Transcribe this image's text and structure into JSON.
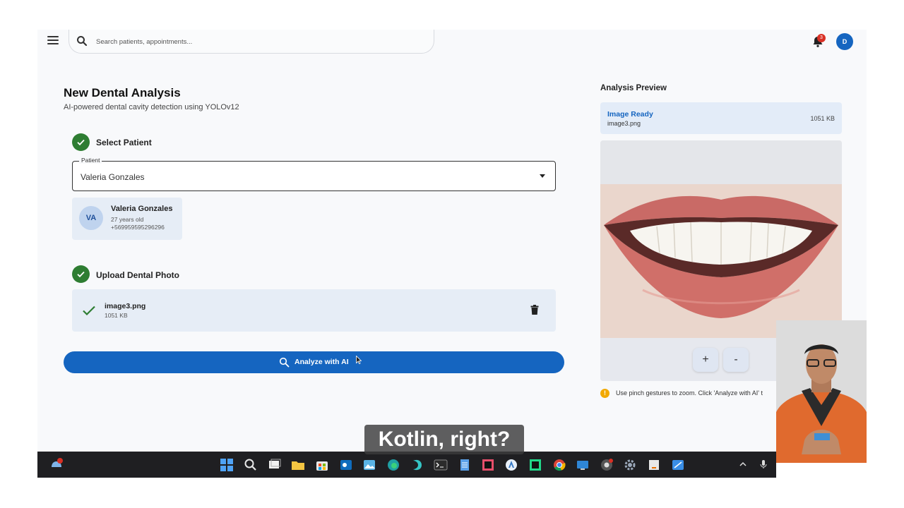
{
  "header": {
    "search_placeholder": "Search patients, appointments...",
    "notification_count": "3",
    "user_initial": "D"
  },
  "page": {
    "title": "New Dental Analysis",
    "subtitle": "AI-powered dental cavity detection using YOLOv12"
  },
  "steps": {
    "select_patient": {
      "label": "Select Patient",
      "field_legend": "Patient",
      "field_value": "Valeria Gonzales",
      "card": {
        "initials": "VA",
        "name": "Valeria Gonzales",
        "age": "27 years old",
        "phone": "+569959595296296"
      }
    },
    "upload_photo": {
      "label": "Upload Dental Photo",
      "file_name": "image3.png",
      "file_size": "1051 KB"
    }
  },
  "actions": {
    "analyze_label": "Analyze with AI"
  },
  "preview": {
    "title": "Analysis Preview",
    "status": "Image Ready",
    "file_name": "image3.png",
    "file_size": "1051 KB",
    "zoom_in": "+",
    "zoom_out": "-",
    "hint": "Use pinch gestures to zoom. Click 'Analyze with AI' t"
  },
  "caption": "Kotlin, right?",
  "colors": {
    "primary": "#1565c0",
    "success": "#2e7d32",
    "card_bg": "#e6edf6",
    "notification": "#d93025",
    "warning": "#f2a900"
  },
  "taskbar": {
    "icons": [
      "notification-icon",
      "windows-start-icon",
      "search-icon",
      "task-view-icon",
      "file-explorer-icon",
      "store-icon",
      "outlook-icon",
      "photos-icon",
      "edge-icon",
      "copilot-icon",
      "terminal-icon",
      "notepad-icon",
      "intellij-icon",
      "android-studio-icon",
      "pycharm-icon",
      "chrome-icon",
      "remote-desktop-icon",
      "chrome-canary-icon",
      "settings-icon",
      "java-icon",
      "snipping-tool-icon"
    ]
  }
}
